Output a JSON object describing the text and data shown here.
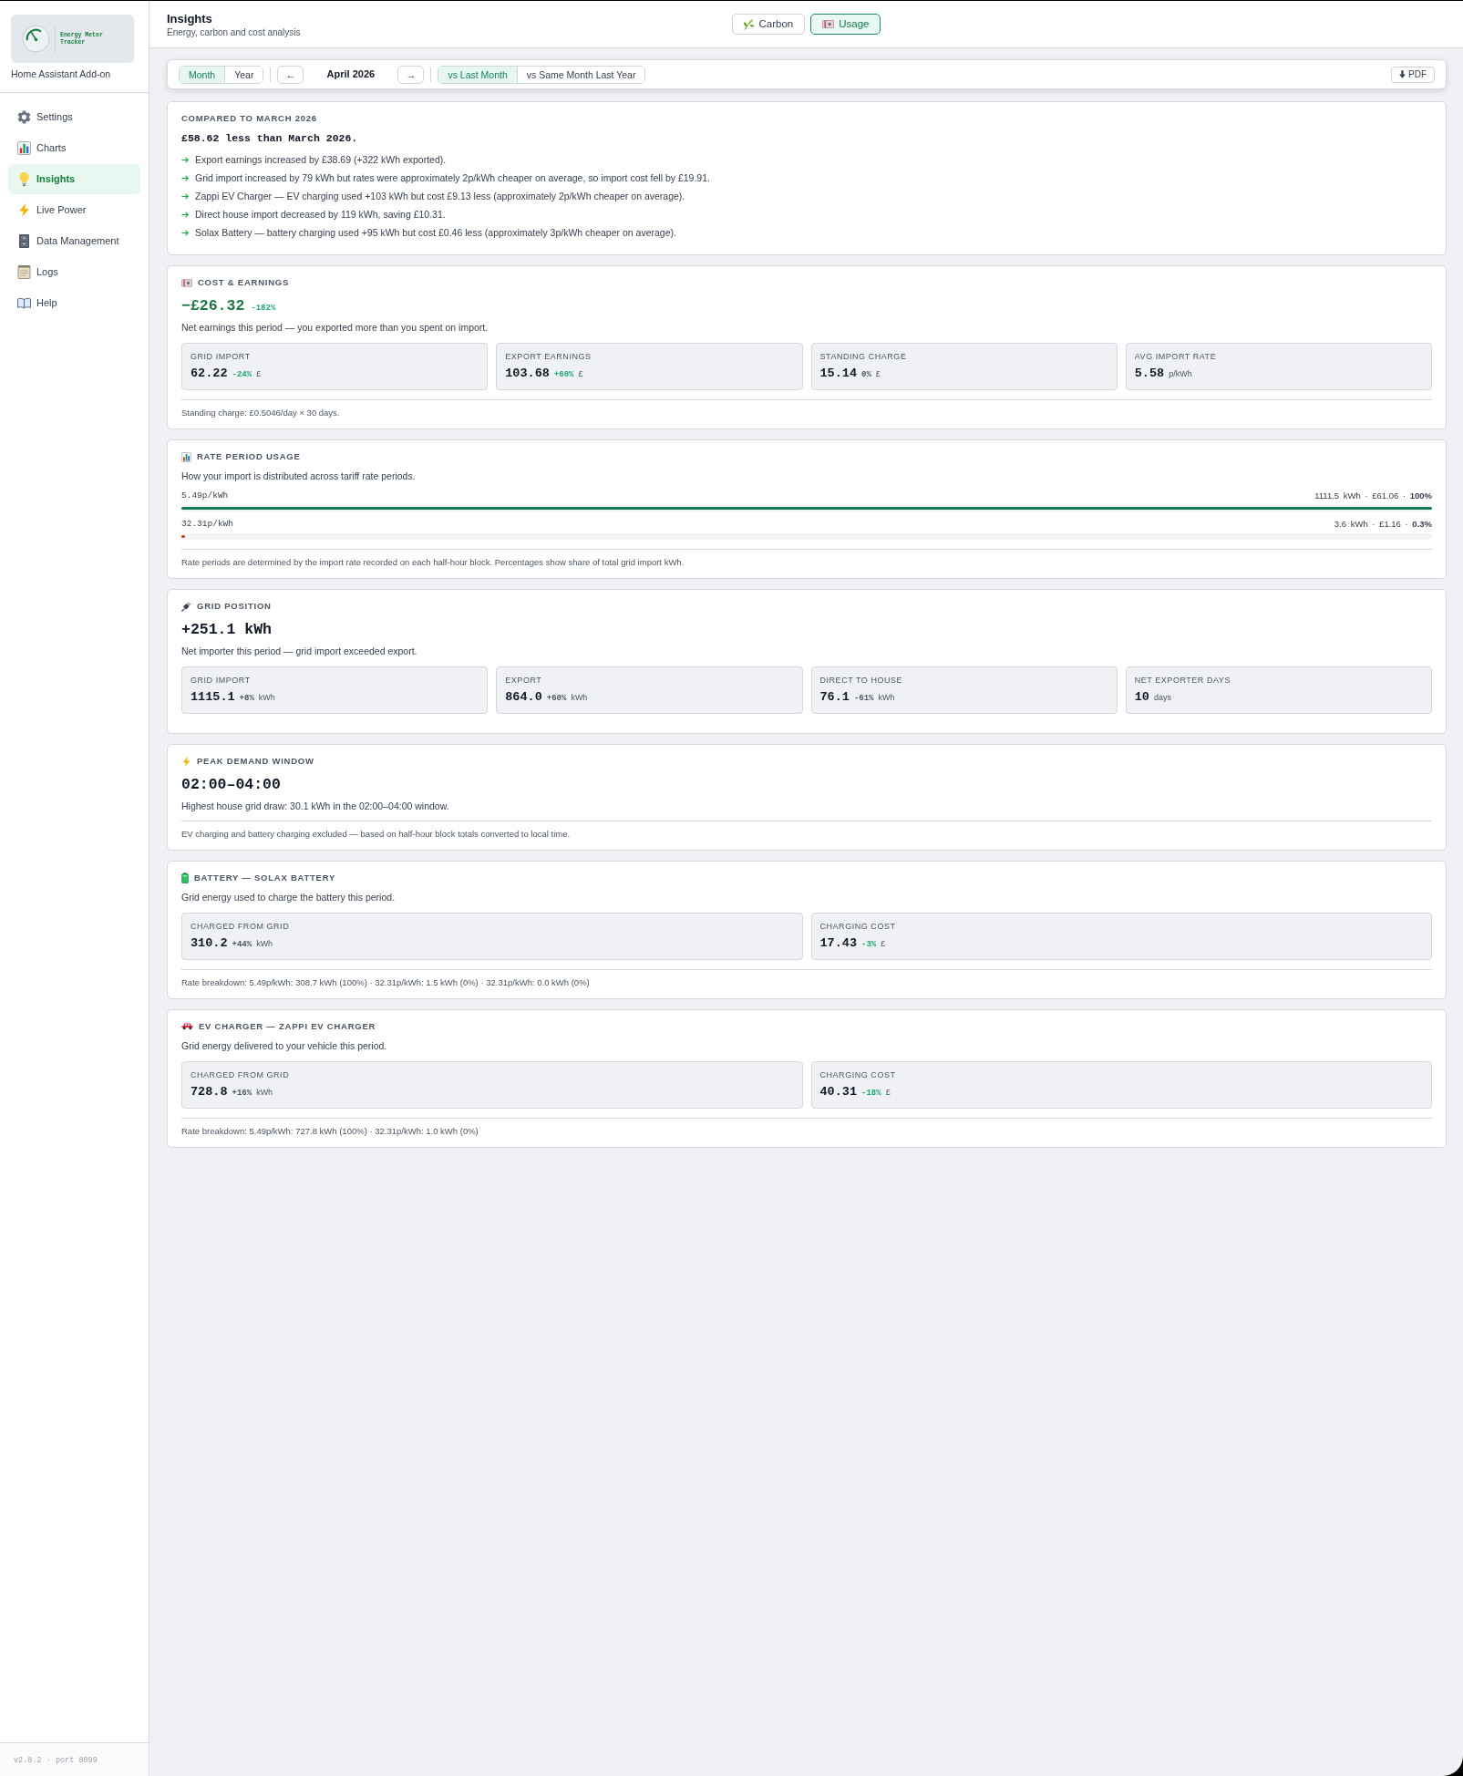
{
  "app": {
    "logo_text": "Energy Meter Tracker",
    "subtitle": "Home Assistant Add-on"
  },
  "sidebar": {
    "items": [
      {
        "label": "Settings",
        "selected": false
      },
      {
        "label": "Charts",
        "selected": false
      },
      {
        "label": "Insights",
        "selected": true
      },
      {
        "label": "Live Power",
        "selected": false
      },
      {
        "label": "Data Management",
        "selected": false
      },
      {
        "label": "Logs",
        "selected": false
      },
      {
        "label": "Help",
        "selected": false
      }
    ],
    "footer": "v2.8.2 · port 8099"
  },
  "header": {
    "title": "Insights",
    "subtitle": "Energy, carbon and cost analysis",
    "tabs": [
      {
        "label": "Carbon",
        "selected": false
      },
      {
        "label": "Usage",
        "selected": true
      }
    ]
  },
  "toolbar": {
    "period_tabs": [
      {
        "label": "Month",
        "selected": true
      },
      {
        "label": "Year",
        "selected": false
      }
    ],
    "previous": "←",
    "period": "April 2026",
    "next": "→",
    "compare_tabs": [
      {
        "label": "vs Last Month",
        "selected": true
      },
      {
        "label": "vs Same Month Last Year",
        "selected": false
      }
    ],
    "export": "PDF"
  },
  "sections": [
    {
      "kind": "comparison",
      "heading": "COMPARED TO MARCH 2026",
      "headline": "£58.62 less than March 2026.",
      "bullets": [
        "Export earnings increased by £38.69 (+322 kWh exported).",
        "Grid import increased by 79 kWh but rates were approximately 2p/kWh cheaper on average, so import cost fell by £19.91.",
        "Zappi EV Charger — EV charging used +103 kWh but cost £9.13 less (approximately 2p/kWh cheaper on average).",
        "Direct house import decreased by 119 kWh, saving £10.31.",
        "Solax Battery — battery charging used +95 kWh but cost £0.46 less (approximately 3p/kWh cheaper on average)."
      ]
    },
    {
      "kind": "metric",
      "heading": "COST & EARNINGS",
      "value": {
        "text": "−£26.32",
        "color": "#1d7a46",
        "change": {
          "text": "-182%",
          "color": "#19a974"
        }
      },
      "description": "Net earnings this period — you exported more than you spent on import.",
      "tiles": [
        {
          "label": "GRID IMPORT",
          "value": "62.22",
          "change": {
            "text": "-24%",
            "color": "#19a974"
          },
          "unit": "£"
        },
        {
          "label": "EXPORT EARNINGS",
          "value": "103.68",
          "change": {
            "text": "+60%",
            "color": "#19a974"
          },
          "unit": "£"
        },
        {
          "label": "STANDING CHARGE",
          "value": "15.14",
          "change": {
            "text": "0%",
            "color": "#4b5563"
          },
          "unit": "£"
        },
        {
          "label": "AVG IMPORT RATE",
          "value": "5.58",
          "unit": "p/kWh"
        }
      ],
      "footnote": "Standing charge: £0.5046/day × 30 days."
    },
    {
      "kind": "rate_periods",
      "heading": "RATE PERIOD USAGE",
      "description": "How your import is distributed across tariff rate periods.",
      "periods": [
        {
          "rate": "5.49p/kWh",
          "summary": "1111.5 kWh · £61.06 · **100%**",
          "level": 1,
          "color": "#127a5b"
        },
        {
          "rate": "32.31p/kWh",
          "summary": "3.6 kWh · £1.16 · **0.3%**",
          "level": 0.003,
          "color": "#c2410c"
        }
      ],
      "footnote": "Rate periods are determined by the import rate recorded on each half-hour block. Percentages show share of total grid import kWh."
    },
    {
      "kind": "metric",
      "heading": "GRID POSITION",
      "value": {
        "text": "+251.1 kWh",
        "color": "#111827"
      },
      "description": "Net importer this period — grid import exceeded export.",
      "tiles": [
        {
          "label": "GRID IMPORT",
          "value": "1115.1",
          "change": {
            "text": "+8%",
            "color": "#4b5563"
          },
          "unit": "kWh"
        },
        {
          "label": "EXPORT",
          "value": "864.0",
          "change": {
            "text": "+60%",
            "color": "#4b5563"
          },
          "unit": "kWh"
        },
        {
          "label": "DIRECT TO HOUSE",
          "value": "76.1",
          "change": {
            "text": "-61%",
            "color": "#4b5563"
          },
          "unit": "kWh"
        },
        {
          "label": "NET EXPORTER DAYS",
          "value": "10",
          "unit": "days"
        }
      ]
    },
    {
      "kind": "metric",
      "heading": "PEAK DEMAND WINDOW",
      "value": {
        "text": "02:00–04:00",
        "color": "#111827"
      },
      "description": "Highest house grid draw: 30.1 kWh in the 02:00–04:00 window.",
      "footnote": "EV charging and battery charging excluded — based on half-hour block totals converted to local time."
    },
    {
      "kind": "metric",
      "heading": "BATTERY — SOLAX BATTERY",
      "description": "Grid energy used to charge the battery this period.",
      "tiles": [
        {
          "label": "CHARGED FROM GRID",
          "value": "310.2",
          "change": {
            "text": "+44%",
            "color": "#4b5563"
          },
          "unit": "kWh"
        },
        {
          "label": "CHARGING COST",
          "value": "17.43",
          "change": {
            "text": "-3%",
            "color": "#19a974"
          },
          "unit": "£"
        }
      ],
      "footnote": "Rate breakdown: 5.49p/kWh: 308.7 kWh (100%) · 32.31p/kWh: 1.5 kWh (0%) · 32.31p/kWh: 0.0 kWh (0%)"
    },
    {
      "kind": "metric",
      "heading": "EV CHARGER — ZAPPI EV CHARGER",
      "description": "Grid energy delivered to your vehicle this period.",
      "tiles": [
        {
          "label": "CHARGED FROM GRID",
          "value": "728.8",
          "change": {
            "text": "+16%",
            "color": "#4b5563"
          },
          "unit": "kWh"
        },
        {
          "label": "CHARGING COST",
          "value": "40.31",
          "change": {
            "text": "-18%",
            "color": "#19a974"
          },
          "unit": "£"
        }
      ],
      "footnote": "Rate breakdown: 5.49p/kWh: 727.8 kWh (100%) · 32.31p/kWh: 1.0 kWh (0%)"
    }
  ]
}
